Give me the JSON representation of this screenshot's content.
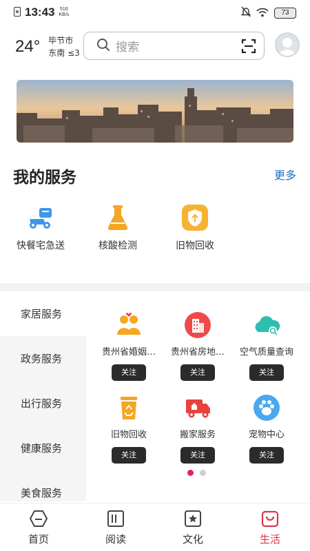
{
  "status_bar": {
    "time": "13:43",
    "net_speed_value": "516",
    "net_speed_unit": "KB/s",
    "battery": "73"
  },
  "header": {
    "temperature": "24°",
    "city": "毕节市",
    "wind": "东南 ≤3",
    "search_placeholder": "搜索"
  },
  "my_services": {
    "title": "我的服务",
    "more_label": "更多",
    "items": [
      {
        "label": "快餐宅急送",
        "icon": "delivery-scooter-icon"
      },
      {
        "label": "核酸检测",
        "icon": "test-flask-icon"
      },
      {
        "label": "旧物回收",
        "icon": "recycle-shield-icon"
      }
    ]
  },
  "categories": {
    "items": [
      "家居服务",
      "政务服务",
      "出行服务",
      "健康服务",
      "美食服务"
    ],
    "active_index": 0
  },
  "grid": {
    "items": [
      {
        "name": "贵州省婚姻…",
        "follow": "关注",
        "icon": "couple-icon"
      },
      {
        "name": "贵州省房地…",
        "follow": "关注",
        "icon": "building-icon"
      },
      {
        "name": "空气质量查询",
        "follow": "关注",
        "icon": "air-quality-icon"
      },
      {
        "name": "旧物回收",
        "follow": "关注",
        "icon": "recycle-bin-icon"
      },
      {
        "name": "搬家服务",
        "follow": "关注",
        "icon": "moving-truck-icon"
      },
      {
        "name": "宠物中心",
        "follow": "关注",
        "icon": "pet-paw-icon"
      }
    ],
    "page_count": 2,
    "current_page": 1
  },
  "tabbar": {
    "tabs": [
      {
        "label": "首页",
        "icon": "home-icon"
      },
      {
        "label": "阅读",
        "icon": "book-icon"
      },
      {
        "label": "文化",
        "icon": "culture-star-icon"
      },
      {
        "label": "生活",
        "icon": "life-bag-icon"
      }
    ],
    "active_index": 3
  },
  "colors": {
    "accent": "#d9364c",
    "link": "#1b6fbf",
    "orange": "#f5a623",
    "red": "#e8413e",
    "teal": "#2bbfae",
    "blue": "#4aa8f0"
  }
}
